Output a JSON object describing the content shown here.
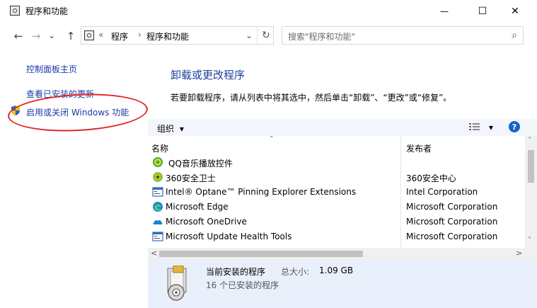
{
  "window": {
    "title": "程序和功能",
    "minimize_glyph": "—",
    "maximize_glyph": "☐",
    "close_glyph": "✕"
  },
  "nav": {
    "back_glyph": "←",
    "forward_glyph": "→",
    "recent_glyph": "⌄",
    "up_glyph": "↑",
    "overflow_glyph": "«",
    "breadcrumb": [
      "程序",
      "程序和功能"
    ],
    "separator_glyph": "›",
    "dropdown_glyph": "⌄",
    "refresh_glyph": "↻"
  },
  "search": {
    "placeholder": "搜索\"程序和功能\"",
    "icon_glyph": "⌕"
  },
  "sidebar": {
    "items": [
      {
        "label": "控制面板主页"
      },
      {
        "label": "查看已安装的更新"
      },
      {
        "label": "启用或关闭 Windows 功能",
        "icon": "shield-icon",
        "highlighted": true
      }
    ],
    "highlight_color": "#e0232a"
  },
  "main": {
    "title": "卸载或更改程序",
    "description": "若要卸载程序，请从列表中将其选中，然后单击“卸载”、“更改”或“修复”。",
    "title_color": "#1e3e9c"
  },
  "toolbar": {
    "organize_label": "组织",
    "organize_dropdown_glyph": "▾",
    "view_dropdown_glyph": "▾",
    "help_label": "?"
  },
  "table": {
    "sort_glyph": "˄",
    "columns": [
      "名称",
      "发布者"
    ],
    "rows": [
      {
        "name": "QQ音乐播放控件",
        "publisher": "",
        "icon": "qq-music-icon"
      },
      {
        "name": "360安全卫士",
        "publisher": "360安全中心",
        "icon": "360-icon"
      },
      {
        "name": "Intel® Optane™ Pinning Explorer Extensions",
        "publisher": "Intel Corporation",
        "icon": "window-app-icon"
      },
      {
        "name": "Microsoft Edge",
        "publisher": "Microsoft Corporation",
        "icon": "edge-icon"
      },
      {
        "name": "Microsoft OneDrive",
        "publisher": "Microsoft Corporation",
        "icon": "onedrive-icon"
      },
      {
        "name": "Microsoft Update Health Tools",
        "publisher": "Microsoft Corporation",
        "icon": "window-app-icon"
      }
    ],
    "scroll_up_glyph": "˄",
    "scroll_down_glyph": "˅",
    "scroll_left_glyph": "<",
    "scroll_right_glyph": ">"
  },
  "details": {
    "title": "当前安装的程序",
    "size_label": "总大小:",
    "size_value": "1.09 GB",
    "count_text": "16 个已安装的程序"
  }
}
